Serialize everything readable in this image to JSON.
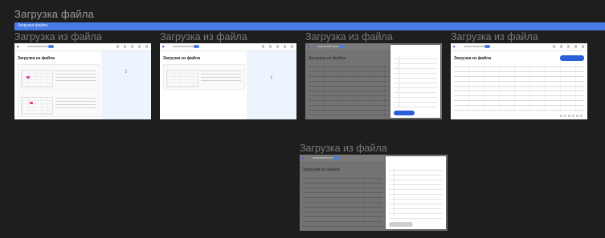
{
  "canvas": {
    "title": "Загрузка файла",
    "banner_label": "Загрузка файла"
  },
  "frames": [
    {
      "label": "Загрузка из файла",
      "page_title": "Загрузка из файла",
      "variant": "upload-two-cards"
    },
    {
      "label": "Загрузка из файла",
      "page_title": "Загрузка из файла",
      "variant": "upload-one-card"
    },
    {
      "label": "Загрузка из файла",
      "page_title": "Загрузка из файла",
      "variant": "table-with-modal"
    },
    {
      "label": "Загрузка из файла",
      "page_title": "Загрузка из файла",
      "variant": "table"
    },
    {
      "label": "Загрузка из файла",
      "page_title": "Загрузка из файла",
      "variant": "table-with-modal-disabled"
    }
  ],
  "colors": {
    "background": "#1e1e1e",
    "banner": "#4a7ce8",
    "accent": "#2b5fd9",
    "highlight": "#e83fa5",
    "overlay": "#737373"
  }
}
